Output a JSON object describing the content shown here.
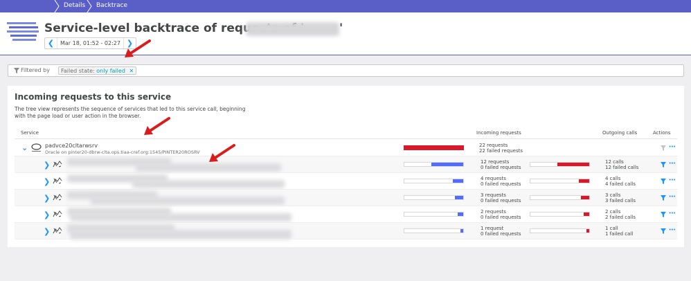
{
  "breadcrumb": {
    "items": [
      "Details",
      "Backtrace"
    ]
  },
  "header": {
    "title_prefix": "Service-level backtrace of requests of '",
    "title_suffix": "'",
    "timeframe": "Mar 18, 01:52 - 02:27",
    "prev_icon": "chevron-left-icon",
    "next_icon": "chevron-right-icon"
  },
  "filter": {
    "label": "Filtered by",
    "chip_key": "Failed state:",
    "chip_value": "only failed",
    "remove_icon": "close-icon"
  },
  "panel": {
    "title": "Incoming requests to this service",
    "description": "The tree view represents the sequence of services that led to this service call, beginning with the page load or user action in the browser."
  },
  "columns": {
    "service": "Service",
    "incoming": "Incoming requests",
    "outgoing": "Outgoing calls",
    "actions": "Actions"
  },
  "root": {
    "name": "padvce20cltarwsrv",
    "subtitle": "Oracle on pinter20-dbrw-clta.ops.tiaa-cref.org:1545/PINTER20ROSRV",
    "requests": "22 requests",
    "failed": "22 failed requests",
    "incoming_fraction": 1.0
  },
  "rows": [
    {
      "requests": "12 requests",
      "failed": "0 failed requests",
      "calls": "12 calls",
      "failed_calls": "12 failed calls",
      "incoming_fraction": 0.545,
      "outgoing_fraction": 0.545
    },
    {
      "requests": "4 requests",
      "failed": "0 failed requests",
      "calls": "4 calls",
      "failed_calls": "4 failed calls",
      "incoming_fraction": 0.18,
      "outgoing_fraction": 0.18
    },
    {
      "requests": "3 requests",
      "failed": "0 failed requests",
      "calls": "3 calls",
      "failed_calls": "3 failed calls",
      "incoming_fraction": 0.136,
      "outgoing_fraction": 0.136
    },
    {
      "requests": "2 requests",
      "failed": "0 failed requests",
      "calls": "2 calls",
      "failed_calls": "2 failed calls",
      "incoming_fraction": 0.09,
      "outgoing_fraction": 0.09
    },
    {
      "requests": "1 request",
      "failed": "0 failed requests",
      "calls": "1 call",
      "failed_calls": "1 failed call",
      "incoming_fraction": 0.045,
      "outgoing_fraction": 0.045
    }
  ],
  "colors": {
    "brand": "#5a5fc8",
    "accent": "#1496ff",
    "incoming_bar": "#526cff",
    "failed_bar": "#dc172a",
    "annotation_arrow": "#d91c1c"
  }
}
